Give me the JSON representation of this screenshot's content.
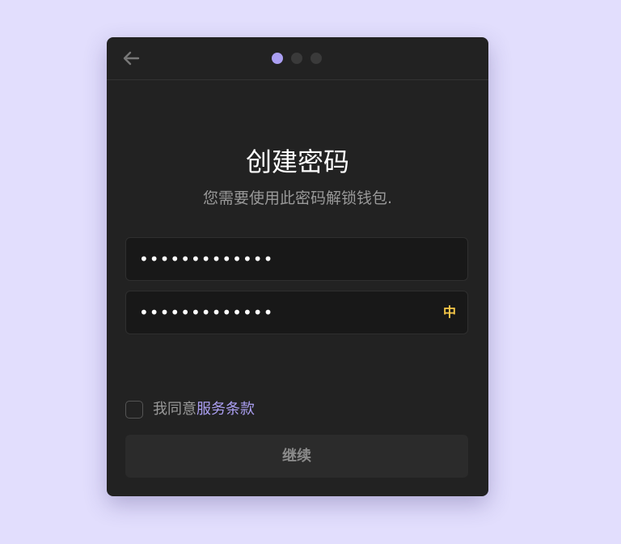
{
  "colors": {
    "background": "#e2defd",
    "panel": "#222222",
    "accent": "#ab9ff2",
    "ime_indicator": "#f6c748"
  },
  "header": {
    "back_icon": "arrow-left-icon",
    "steps": [
      {
        "active": true
      },
      {
        "active": false
      },
      {
        "active": false
      }
    ]
  },
  "main": {
    "title": "创建密码",
    "subtitle": "您需要使用此密码解锁钱包."
  },
  "password": {
    "value_masked": "•••••••••••••"
  },
  "confirm_password": {
    "value_masked": "•••••••••••••",
    "ime_indicator": "中"
  },
  "agreement": {
    "checked": false,
    "prefix": "我同意",
    "link_text": "服务条款"
  },
  "continue_button": {
    "label": "继续",
    "enabled": false
  }
}
